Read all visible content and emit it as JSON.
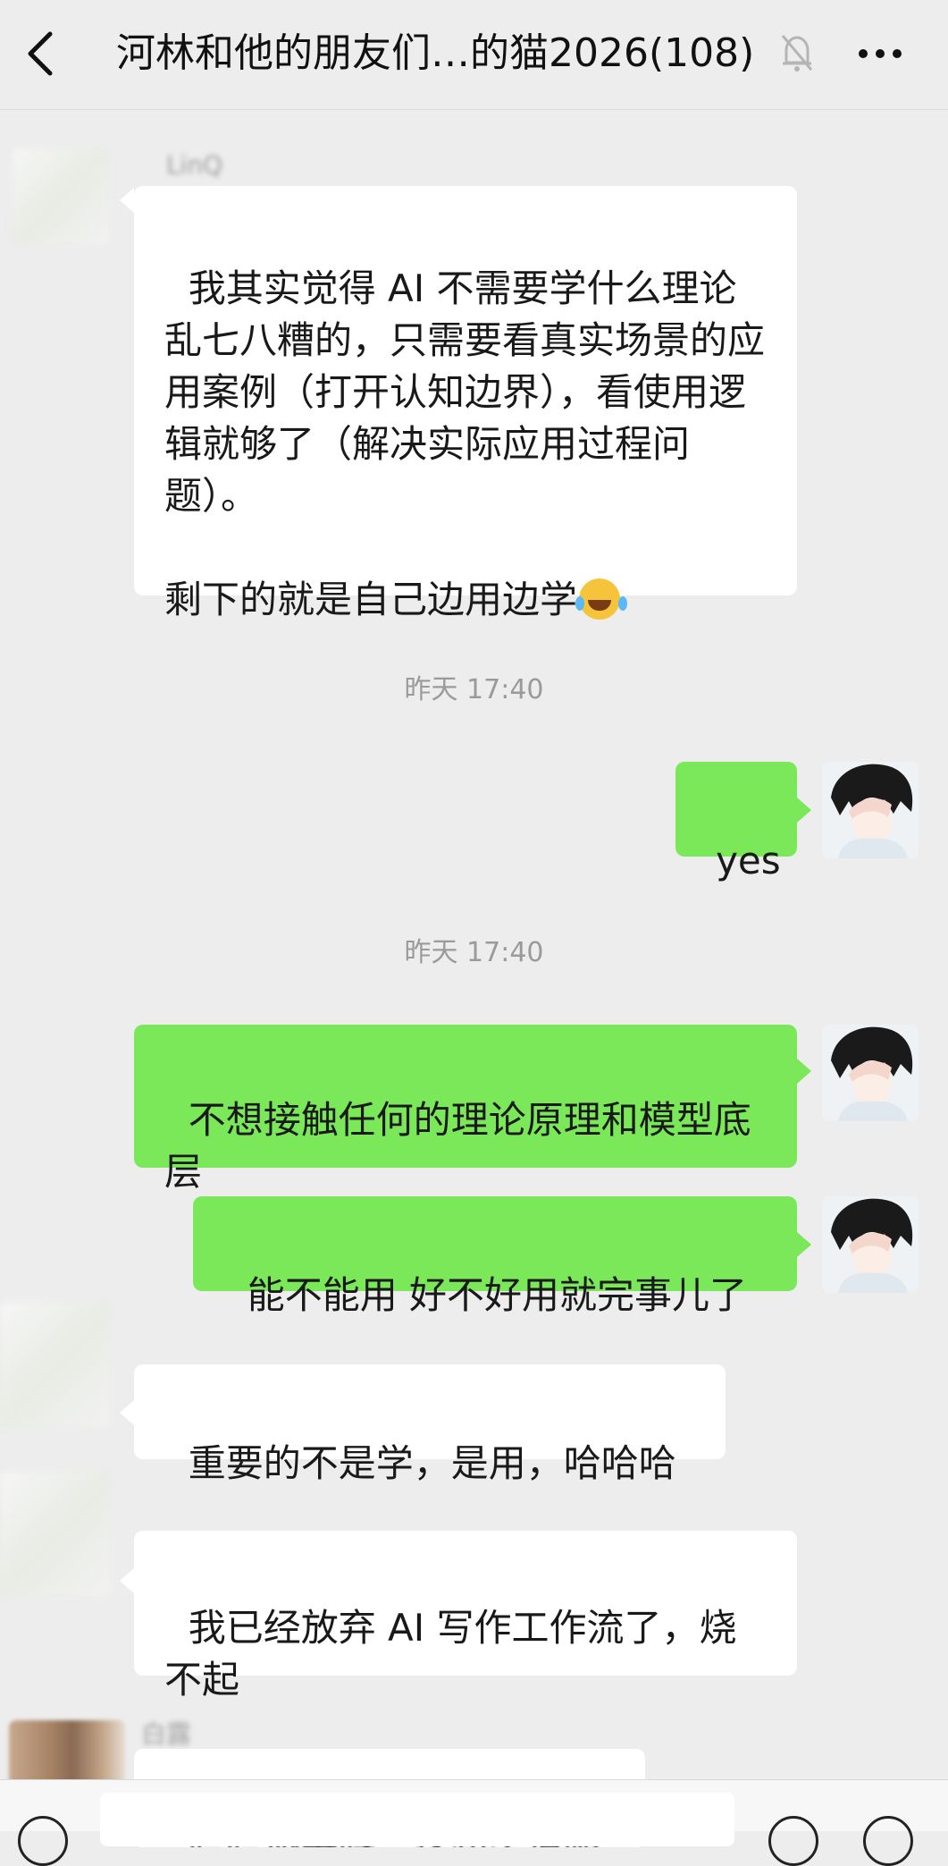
{
  "header": {
    "title": "河林和他的朋友们…的猫2026(108)",
    "back_icon": "chevron-left-icon",
    "mute_icon": "bell-off-icon",
    "more_icon": "more-dots-icon"
  },
  "messages": [
    {
      "sender": "LinQ",
      "text": "我其实觉得 AI 不需要学什么理论乱七八糟的，只需要看真实场景的应用案例（打开认知边界），看使用逻辑就够了（解决实际应用过程问题）。\n\n剩下的就是自己边用边学"
    },
    {
      "time": "昨天 17:40"
    },
    {
      "text": "yes"
    },
    {
      "time": "昨天 17:40"
    },
    {
      "text": "不想接触任何的理论原理和模型底层"
    },
    {
      "text": "能不能用 好不好用就完事儿了"
    },
    {
      "text": "重要的不是学，是用，哈哈哈"
    },
    {
      "text": "我已经放弃 AI 写作工作流了，烧不起"
    },
    {
      "sender": "白露",
      "text": "哈哈协书呀，这句么说呢"
    }
  ],
  "colors": {
    "background": "#ededed",
    "incoming": "#ffffff",
    "outgoing": "#7ae858"
  }
}
